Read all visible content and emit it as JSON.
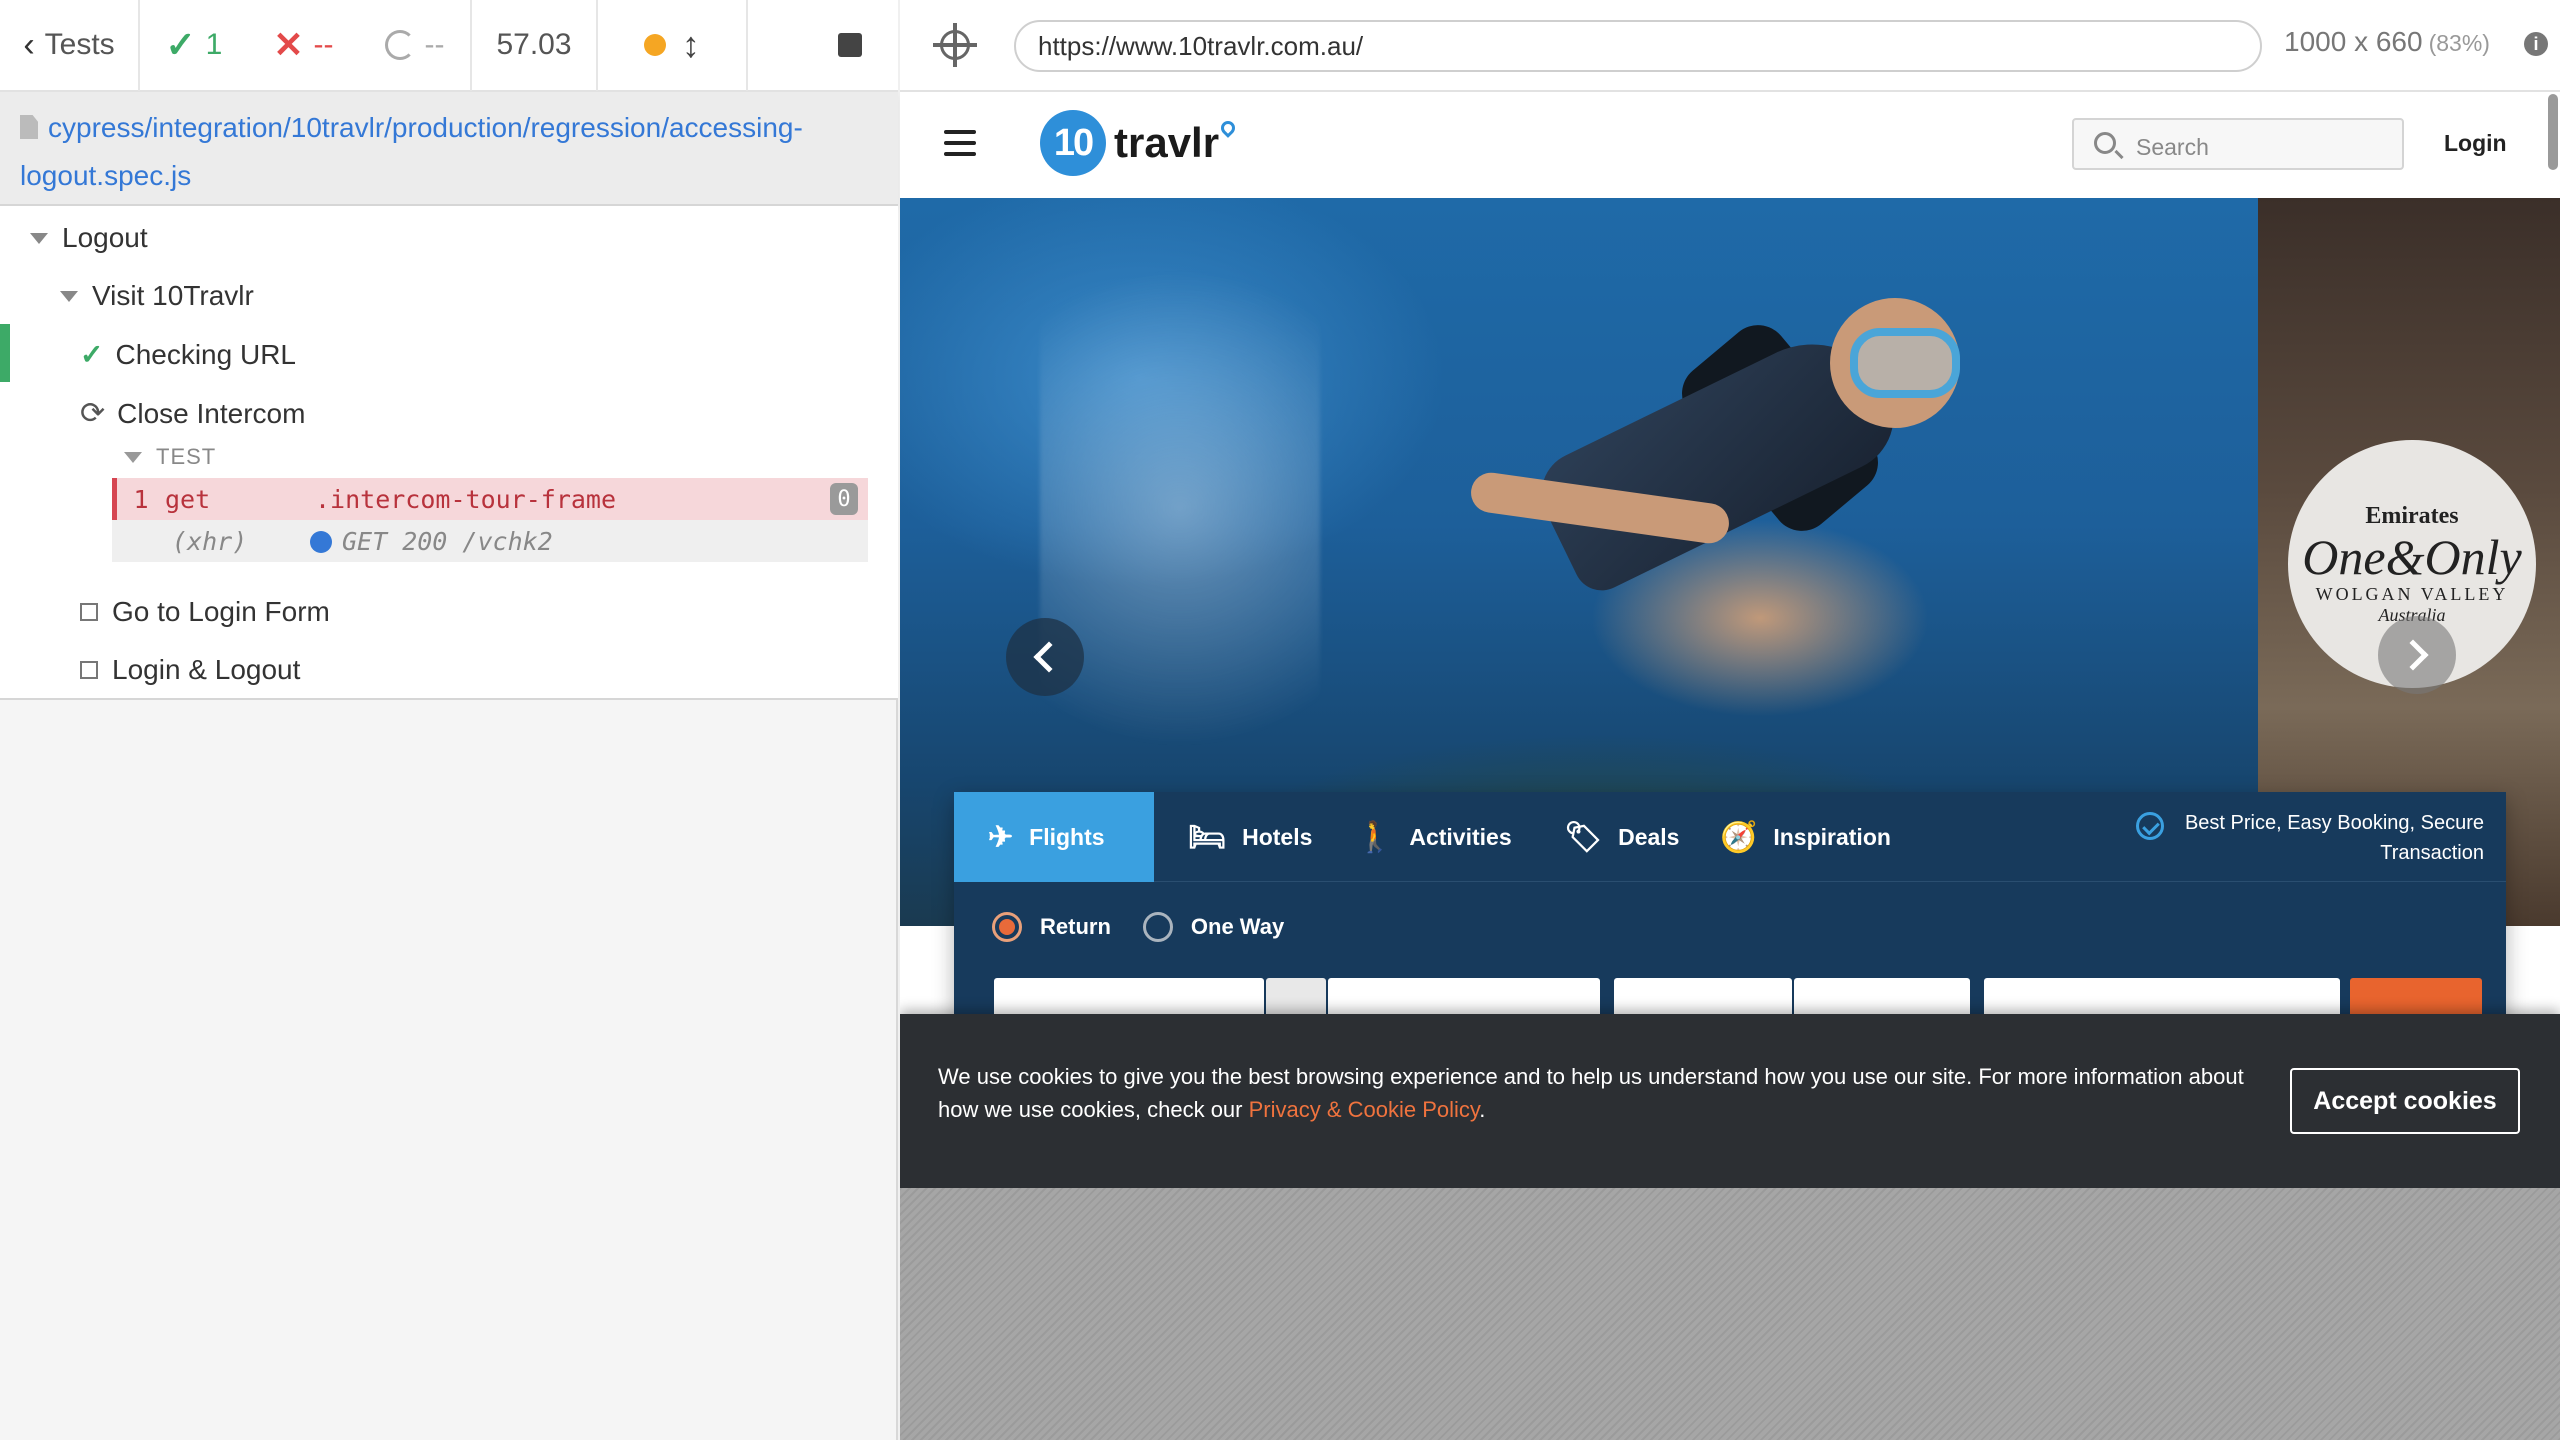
{
  "reporter": {
    "tests_label": "Tests",
    "passed": "1",
    "failed": "--",
    "pending": "--",
    "duration": "57.03",
    "spec_path": "cypress/integration/10travlr/production/regression/accessing-logout.spec.js",
    "suite": "Logout",
    "subsuite": "Visit 10Travlr",
    "tests": [
      {
        "title": "Checking URL",
        "state": "passed"
      },
      {
        "title": "Close Intercom",
        "state": "running"
      },
      {
        "title": "Go to Login Form",
        "state": "pending"
      },
      {
        "title": "Login & Logout",
        "state": "pending"
      }
    ],
    "hook_label": "TEST",
    "commands": [
      {
        "number": "1",
        "name": "get",
        "message": ".intercom-tour-frame",
        "badge": "0"
      },
      {
        "number": "",
        "name": "(xhr)",
        "message": "GET 200 /vchk2",
        "badge": ""
      }
    ]
  },
  "aut": {
    "url": "https://www.10travlr.com.au/",
    "viewport": "1000 x 660",
    "scale": "(83%)"
  },
  "site": {
    "logo_badge": "10",
    "logo_text": "travlr",
    "search_placeholder": "Search",
    "login_label": "Login",
    "promo": {
      "line1": "Emirates",
      "line2": "One&Only",
      "line3": "WOLGAN VALLEY",
      "line4": "Australia"
    },
    "tabs": [
      {
        "label": "Flights",
        "icon": "plane-icon"
      },
      {
        "label": "Hotels",
        "icon": "bed-icon"
      },
      {
        "label": "Activities",
        "icon": "walking-icon"
      },
      {
        "label": "Deals",
        "icon": "tag-icon"
      },
      {
        "label": "Inspiration",
        "icon": "compass-icon"
      }
    ],
    "trust_text": "Best Price, Easy Booking, Secure Transaction",
    "trip_types": [
      "Return",
      "One Way"
    ],
    "cookie": {
      "text": "We use cookies to give you the best browsing experience and to help us understand how you use our site. For more information about how we use cookies, check our",
      "policy_link": "Privacy & Cookie Policy",
      "end": ".",
      "accept": "Accept cookies"
    }
  },
  "colors": {
    "accent": "#3aa0e0",
    "navy": "#173a5c",
    "pass": "#3daa67",
    "fail": "#e34a4a",
    "orange": "#e8642e"
  }
}
